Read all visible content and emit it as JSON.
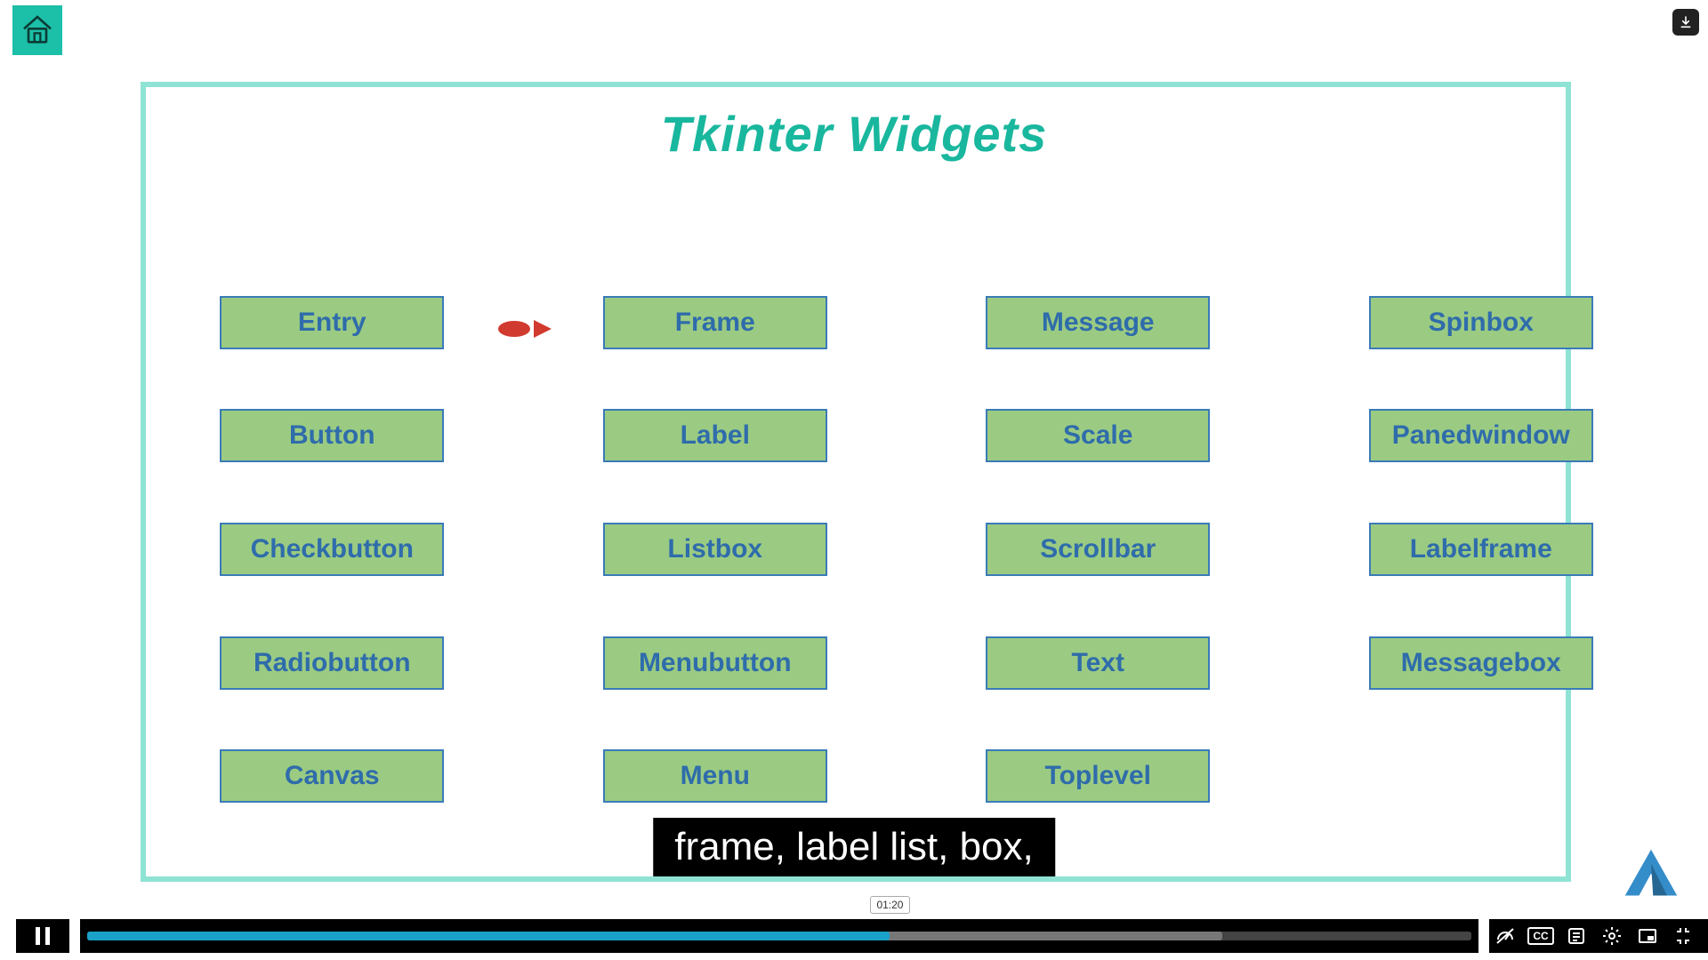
{
  "slide": {
    "title": "Tkinter Widgets",
    "columns": [
      [
        "Entry",
        "Button",
        "Checkbutton",
        "Radiobutton",
        "Canvas"
      ],
      [
        "Frame",
        "Label",
        "Listbox",
        "Menubutton",
        "Menu"
      ],
      [
        "Message",
        "Scale",
        "Scrollbar",
        "Text",
        "Toplevel"
      ],
      [
        "Spinbox",
        "Panedwindow",
        "Labelframe",
        "Messagebox"
      ]
    ],
    "highlighted": "Frame"
  },
  "caption": {
    "text": "frame, label list, box,"
  },
  "player": {
    "progress_pct": 58,
    "buffer_pct": 82,
    "tooltip_time": "01:20",
    "cc_label": "CC"
  }
}
